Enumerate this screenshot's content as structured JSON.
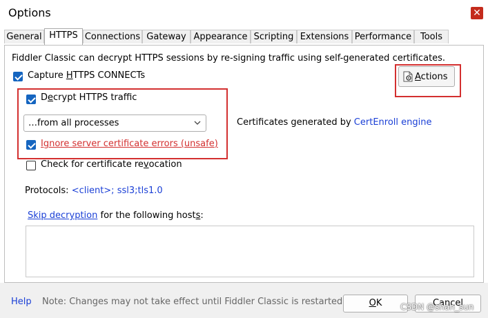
{
  "window": {
    "title": "Options",
    "close_glyph": "✕"
  },
  "tabs": [
    {
      "label": "General"
    },
    {
      "label": "HTTPS"
    },
    {
      "label": "Connections"
    },
    {
      "label": "Gateway"
    },
    {
      "label": "Appearance"
    },
    {
      "label": "Scripting"
    },
    {
      "label": "Extensions"
    },
    {
      "label": "Performance"
    },
    {
      "label": "Tools"
    }
  ],
  "https": {
    "description": "Fiddler Classic can decrypt HTTPS sessions by re-signing traffic using self-generated certificates.",
    "capture_connects": {
      "pre": "Capture ",
      "accel": "H",
      "post": "TTPS CONNECTs",
      "checked": true
    },
    "decrypt_traffic": {
      "pre": "D",
      "accel": "e",
      "post": "crypt HTTPS traffic",
      "checked": true
    },
    "process_filter": {
      "selected": "…from all processes"
    },
    "certs_generated": {
      "prefix": "Certificates generated by ",
      "engine_link": "CertEnroll engine"
    },
    "ignore_errors": {
      "label": "Ignore server certificate errors (unsafe)",
      "checked": true
    },
    "revocation": {
      "pre": "Check for certificate re",
      "accel": "v",
      "post": "ocation",
      "checked": false
    },
    "protocols": {
      "label": "Protocols: ",
      "value": "<client>; ssl3;tls1.0"
    },
    "skip": {
      "link": "Skip decryption",
      "mid": " for the following host",
      "accel": "s",
      "post": ":",
      "hosts_value": ""
    },
    "actions_button": {
      "accel": "A",
      "post": "ctions"
    }
  },
  "footer": {
    "help": "Help",
    "note": "Note: Changes may not take effect until Fiddler Classic is restarted.",
    "ok": {
      "accel": "O",
      "post": "K"
    },
    "cancel": "Cancel"
  },
  "watermark": "CSDN @shan_sun",
  "colors": {
    "accent": "#1565c0",
    "highlight_box": "#d32f2f",
    "link": "#1a3fd6",
    "warning_text": "#d32f2f"
  }
}
